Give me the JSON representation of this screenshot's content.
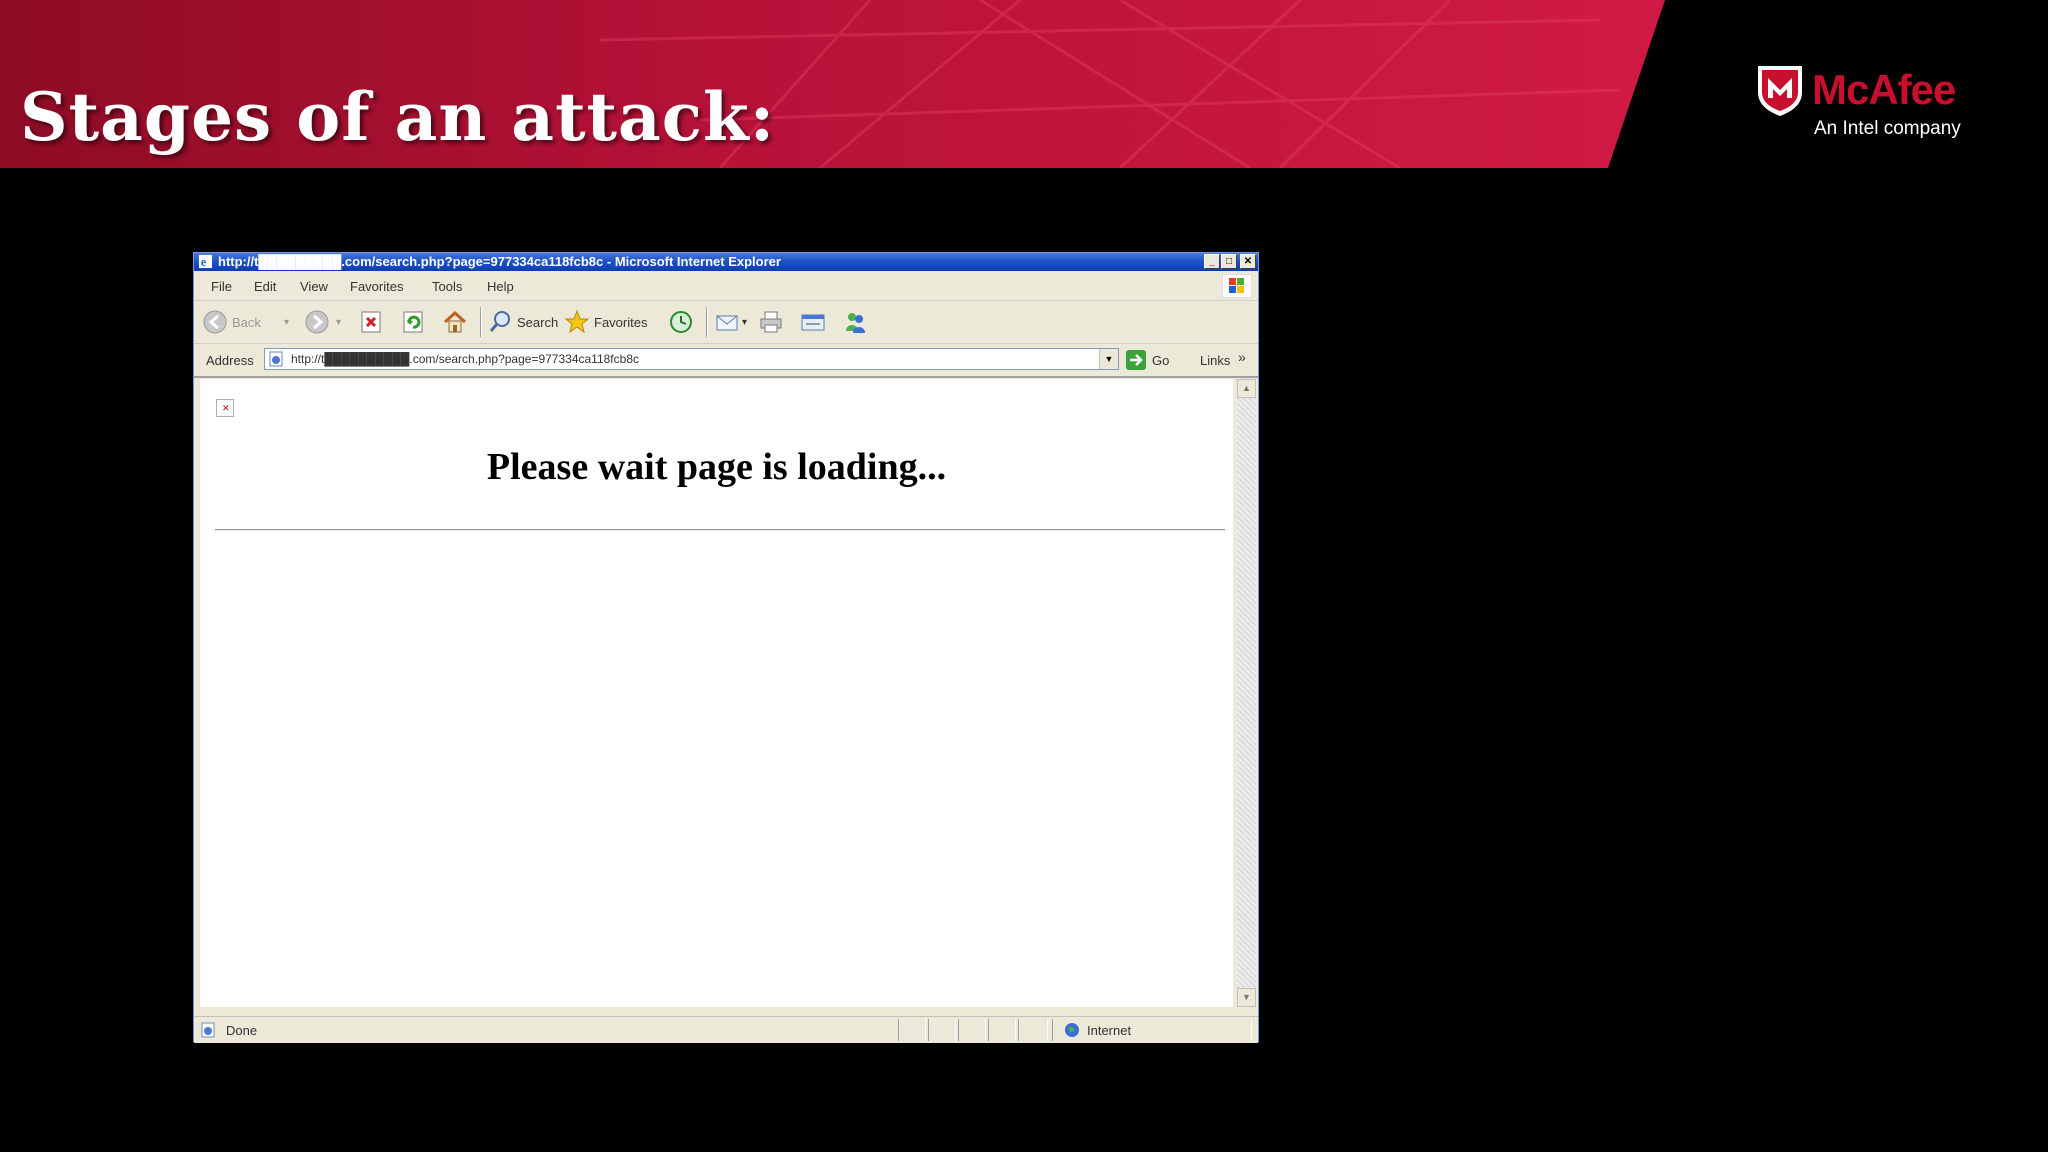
{
  "slide": {
    "title": "Stages of an attack:",
    "logo": {
      "name": "McAfee",
      "tagline": "An Intel company"
    }
  },
  "browser": {
    "window_title": "http://t█████████.com/search.php?page=977334ca118fcb8c - Microsoft Internet Explorer",
    "menu": [
      "File",
      "Edit",
      "View",
      "Favorites",
      "Tools",
      "Help"
    ],
    "toolbar": {
      "back_label": "Back",
      "search_label": "Search",
      "favorites_label": "Favorites"
    },
    "address": {
      "label": "Address",
      "url": "http://t██████████.com/search.php?page=977334ca118fcb8c",
      "go_label": "Go",
      "links_label": "Links",
      "links_more": "»"
    },
    "page": {
      "heading": "Please wait page is loading..."
    },
    "status": {
      "text": "Done",
      "zone": "Internet"
    }
  },
  "colors": {
    "header_red": "#b5123a",
    "mcafee_red": "#c8102e",
    "xp_blue": "#0a3cb5"
  }
}
